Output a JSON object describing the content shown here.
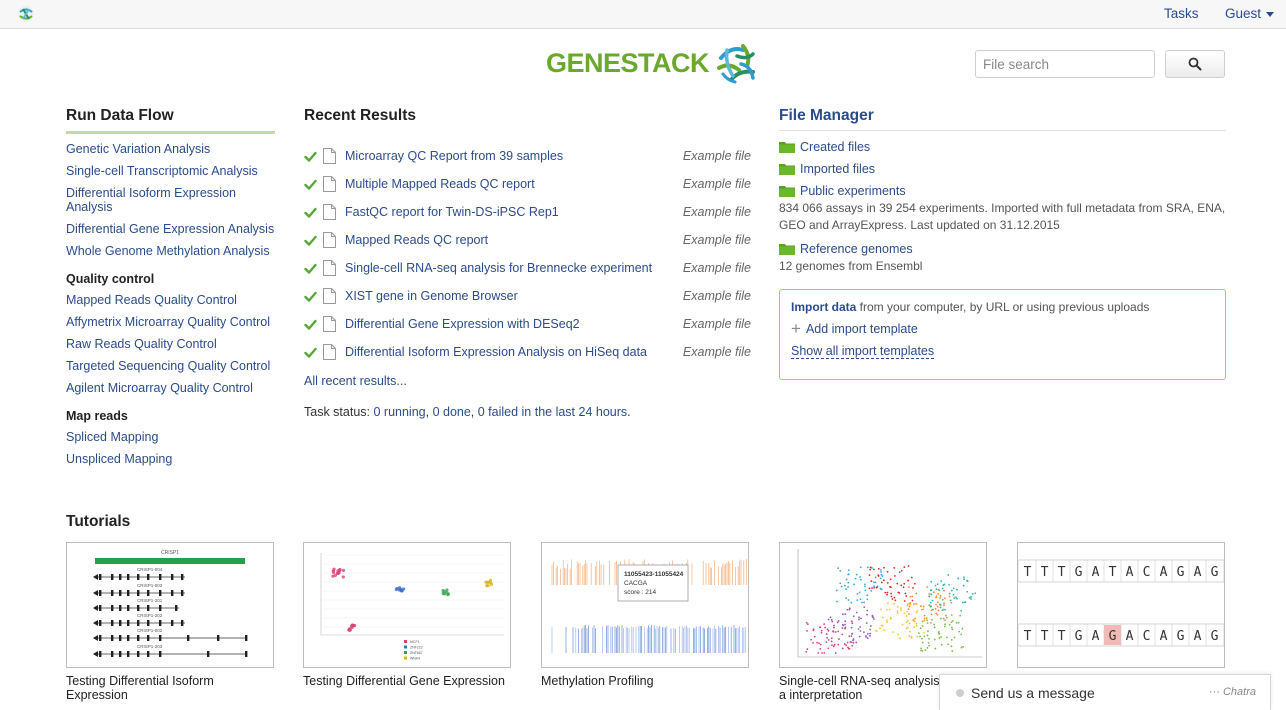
{
  "topbar": {
    "tasks": "Tasks",
    "guest": "Guest"
  },
  "logo": {
    "text": "GENESTACK"
  },
  "search": {
    "placeholder": "File search"
  },
  "run_data_flow": {
    "title": "Run Data Flow",
    "items": [
      "Genetic Variation Analysis",
      "Single-cell Transcriptomic Analysis",
      "Differential Isoform Expression Analysis",
      "Differential Gene Expression Analysis",
      "Whole Genome Methylation Analysis"
    ],
    "quality_control": {
      "heading": "Quality control",
      "items": [
        "Mapped Reads Quality Control",
        "Affymetrix Microarray Quality Control",
        "Raw Reads Quality Control",
        "Targeted Sequencing Quality Control",
        "Agilent Microarray Quality Control"
      ]
    },
    "map_reads": {
      "heading": "Map reads",
      "items": [
        "Spliced Mapping",
        "Unspliced Mapping"
      ]
    }
  },
  "recent_results": {
    "title": "Recent Results",
    "items": [
      {
        "name": "Microarray QC Report from 39 samples",
        "tag": "Example file"
      },
      {
        "name": "Multiple Mapped Reads QC report",
        "tag": "Example file"
      },
      {
        "name": "FastQC report for Twin-DS-iPSC Rep1",
        "tag": "Example file"
      },
      {
        "name": "Mapped Reads QC report",
        "tag": "Example file"
      },
      {
        "name": "Single-cell RNA-seq analysis for Brennecke experiment",
        "tag": "Example file"
      },
      {
        "name": "XIST gene in Genome Browser",
        "tag": "Example file"
      },
      {
        "name": "Differential Gene Expression with DESeq2",
        "tag": "Example file"
      },
      {
        "name": "Differential Isoform Expression Analysis on HiSeq data",
        "tag": "Example file"
      }
    ],
    "all_link": "All recent results...",
    "task_status": {
      "label": "Task status: ",
      "running": "0 running",
      "done": "0 done",
      "failed": "0 failed in the last 24 hours",
      "sep": ", ",
      "end": "."
    }
  },
  "file_manager": {
    "title": "File Manager",
    "created": "Created files",
    "imported": "Imported files",
    "public": "Public experiments",
    "public_desc": "834 066 assays in 39 254 experiments. Imported with full metadata from SRA, ENA, GEO and ArrayExpress. Last updated on 31.12.2015",
    "reference": "Reference genomes",
    "reference_desc": "12 genomes from Ensembl",
    "import": {
      "bold": "Import data",
      "rest": " from your computer, by URL or using previous uploads",
      "add_template": "Add import template",
      "show_all": "Show all import templates"
    }
  },
  "tutorials": {
    "title": "Tutorials",
    "items": [
      "Testing Differential Isoform Expression",
      "Testing Differential Gene Expression",
      "Methylation Profiling",
      "Single-cell RNA-seq analysis a interpretation",
      ""
    ],
    "thumb_text": {
      "crisp1": "CRISP1",
      "iso_labels": [
        "CRISP1-004",
        "CRISP1-003",
        "CRISP1-201",
        "CRISP1-202",
        "CRISP1-002",
        "CRISP1-203"
      ],
      "legend": [
        "MCF1",
        "ZNF222",
        "ZNF667",
        "WNK4"
      ],
      "methyl_range": "11055423-11055424",
      "methyl_seq": "CACGA",
      "methyl_score": "score : 214",
      "seq_top": [
        "T",
        "T",
        "T",
        "G",
        "A",
        "T",
        "A",
        "C",
        "A",
        "G",
        "A",
        "G"
      ],
      "seq_bottom": [
        "T",
        "T",
        "T",
        "G",
        "A",
        "G",
        "A",
        "C",
        "A",
        "G",
        "A",
        "G"
      ]
    }
  },
  "chat": {
    "message": "Send us a message",
    "brand": "Chatra"
  },
  "colors": {
    "link": "#2b4c8c",
    "brand_green": "#6aa92d",
    "check": "#5aa63a",
    "import_border": "#9fcf74"
  }
}
